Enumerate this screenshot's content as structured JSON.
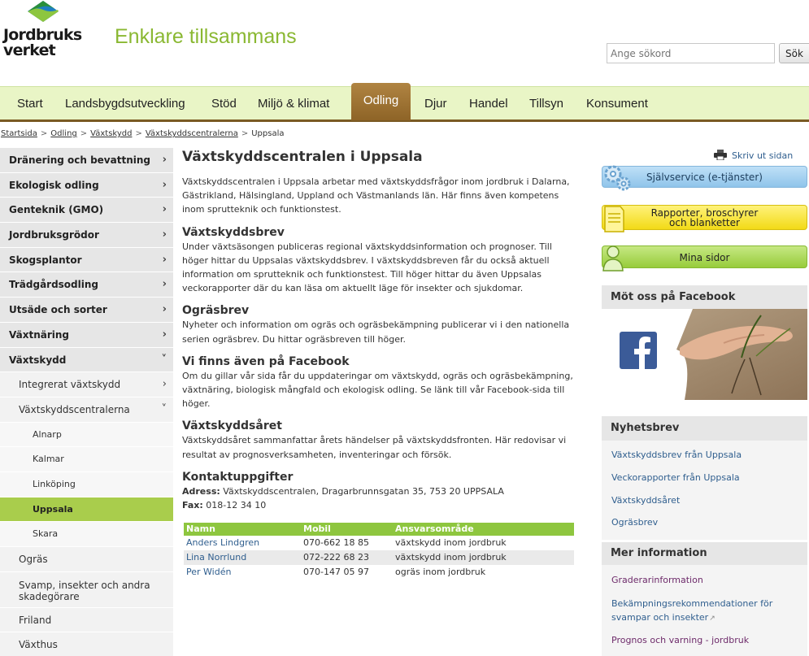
{
  "header": {
    "logo_line1": "Jordbruks",
    "logo_line2": "verket",
    "tagline": "Enklare tillsammans",
    "search_placeholder": "Ange sökord",
    "search_button": "Sök"
  },
  "nav": {
    "items": [
      "Start",
      "Landsbygdsutveckling",
      "Stöd",
      "Miljö & klimat",
      "Odling",
      "Djur",
      "Handel",
      "Tillsyn",
      "Konsument"
    ],
    "active": "Odling"
  },
  "breadcrumb": {
    "links": [
      "Startsida",
      "Odling",
      "Växtskydd",
      "Växtskyddscentralerna"
    ],
    "current": "Uppsala",
    "separator": ">"
  },
  "sidebar": {
    "items": [
      {
        "label": "Dränering och bevattning",
        "chevron": "›"
      },
      {
        "label": "Ekologisk odling",
        "chevron": "›"
      },
      {
        "label": "Genteknik (GMO)",
        "chevron": "›"
      },
      {
        "label": "Jordbruksgrödor",
        "chevron": "›"
      },
      {
        "label": "Skogsplantor",
        "chevron": "›"
      },
      {
        "label": "Trädgårdsodling",
        "chevron": "›"
      },
      {
        "label": "Utsäde och sorter",
        "chevron": "›"
      },
      {
        "label": "Växtnäring",
        "chevron": "›"
      },
      {
        "label": "Växtskydd",
        "chevron": "˅"
      },
      {
        "label": "Integrerat växtskydd",
        "chevron": "›"
      },
      {
        "label": "Växtskyddscentralerna",
        "chevron": "˅"
      },
      {
        "label": "Alnarp"
      },
      {
        "label": "Kalmar"
      },
      {
        "label": "Linköping"
      },
      {
        "label": "Uppsala"
      },
      {
        "label": "Skara"
      },
      {
        "label": "Ogräs"
      },
      {
        "label": "Svamp, insekter och andra skadegörare"
      },
      {
        "label": "Friland"
      },
      {
        "label": "Växthus"
      }
    ]
  },
  "main": {
    "title": "Växtskyddscentralen i Uppsala",
    "intro": "Växtskyddscentralen i Uppsala arbetar med växtskyddsfrågor inom jordbruk i Dalarna, Gästrikland, Hälsingland, Uppland och Västmanlands län. Här finns även kompetens inom sprutteknik och funktionstest.",
    "sections": [
      {
        "heading": "Växtskyddsbrev",
        "text": "Under växtsäsongen publiceras regional växtskyddsinformation och prognoser. Till höger hittar du Uppsalas växtskyddsbrev. I växtskyddsbreven får du också aktuell information om sprutteknik och funktionstest. Till höger hittar du även Uppsalas veckorapporter där du kan läsa om aktuellt läge för insekter och sjukdomar."
      },
      {
        "heading": "Ogräsbrev",
        "text": "Nyheter och information om ogräs och ogräsbekämpning publicerar vi i den nationella serien ogräsbrev. Du hittar ogräsbreven till höger."
      },
      {
        "heading": "Vi finns även på Facebook",
        "text": "Om du gillar vår sida får du uppdateringar om växtskydd, ogräs och ogräsbekämpning, växtnäring, biologisk mångfald och ekologisk odling. Se länk till vår Facebook-sida till höger."
      },
      {
        "heading": "Växtskyddsåret",
        "text": "Växtskyddsåret sammanfattar årets händelser på växtskyddsfronten. Här redovisar vi resultat av prognosverksamheten, inventeringar och försök."
      }
    ],
    "contact": {
      "heading": "Kontaktuppgifter",
      "address_label": "Adress:",
      "address": "Växtskyddscentralen, Dragarbrunnsgatan 35, 753 20 UPPSALA",
      "fax_label": "Fax:",
      "fax": "018-12 34 10"
    },
    "table": {
      "headers": [
        "Namn",
        "Mobil",
        "Ansvarsområde"
      ],
      "rows": [
        [
          "Anders Lindgren",
          "070-662 18 85",
          "växtskydd inom jordbruk"
        ],
        [
          "Lina Norrlund",
          "072-222 68 23",
          "växtskydd inom jordbruk"
        ],
        [
          "Per Widén",
          "070-147 05 97",
          "ogräs inom jordbruk"
        ]
      ]
    }
  },
  "right": {
    "print_label": "Skriv ut sidan",
    "btn_self_service": "Självservice (e-tjänster)",
    "btn_reports_line1": "Rapporter, broschyrer",
    "btn_reports_line2": "och blanketter",
    "btn_my_pages": "Mina sidor",
    "facebook_heading": "Möt oss på Facebook",
    "newsletter": {
      "heading": "Nyhetsbrev",
      "links": [
        "Växtskyddsbrev från Uppsala",
        "Veckorapporter från Uppsala",
        "Växtskyddsåret",
        "Ogräsbrev"
      ]
    },
    "more_info": {
      "heading": "Mer information",
      "links": [
        "Graderarinformation",
        "Bekämpningsrekommendationer för svampar och insekter",
        "Prognos och varning - jordbruk"
      ]
    }
  },
  "colors": {
    "accent_green": "#8ec63f",
    "nav_brown": "#8e6427",
    "link_blue": "#2f5e8e",
    "tagline_green": "#8ab832"
  }
}
